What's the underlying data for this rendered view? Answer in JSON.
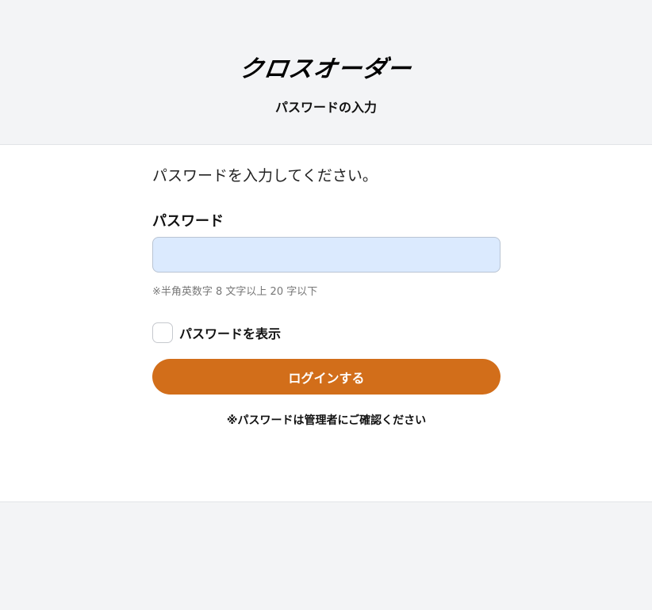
{
  "header": {
    "logo_text": "クロスオーダー",
    "title": "パスワードの入力"
  },
  "form": {
    "instruction": "パスワードを入力してください。",
    "password_label": "パスワード",
    "password_value": "",
    "password_placeholder": "",
    "hint": "※半角英数字 8 文字以上 20 字以下",
    "show_password_label": "パスワードを表示",
    "show_password_checked": false,
    "login_button_label": "ログインする",
    "notice": "※パスワードは管理者にご確認ください"
  },
  "colors": {
    "accent": "#d26e1a",
    "input_background": "#dbeafe",
    "page_background": "#f3f4f6"
  }
}
